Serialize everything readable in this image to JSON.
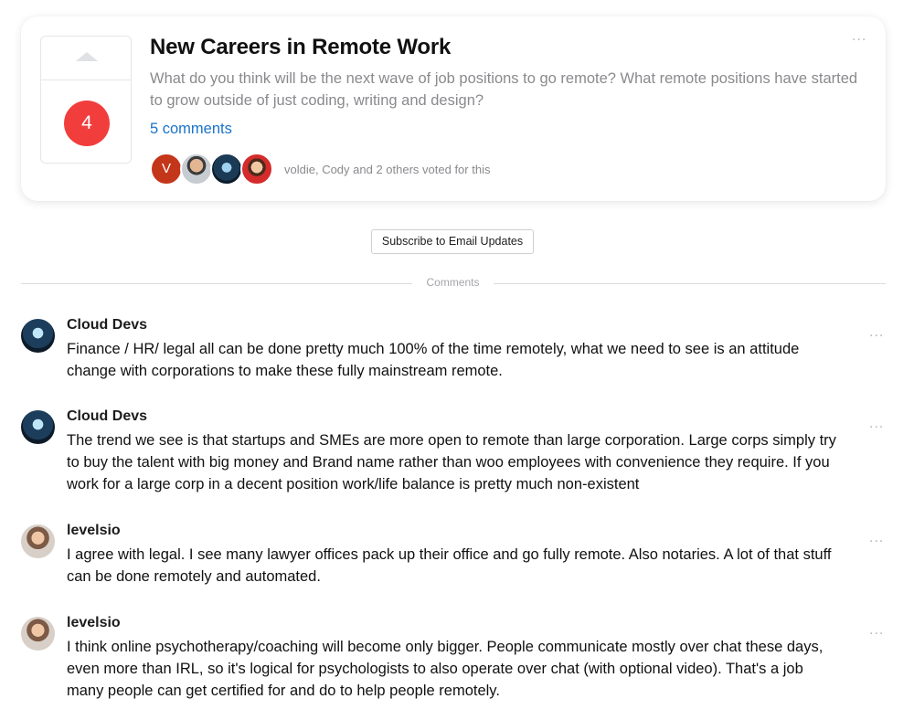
{
  "post": {
    "title": "New Careers in Remote Work",
    "description": "What do you think will be the next wave of job positions to go remote? What remote positions have started to grow outside of just coding, writing and design?",
    "comments_link": "5 comments",
    "vote_count": "4",
    "voters": [
      {
        "initial": "V",
        "color": "#c4361a"
      },
      {
        "initial": ""
      },
      {
        "initial": ""
      },
      {
        "initial": ""
      }
    ],
    "voters_text": "voldie, Cody and 2 others voted for this",
    "more_icon": "..."
  },
  "subscribe_label": "Subscribe to Email Updates",
  "comments_label": "Comments",
  "comments": [
    {
      "author": "Cloud Devs",
      "text": "Finance / HR/ legal all can be done pretty much 100% of the time remotely, what we need to see is an attitude change with corporations to make these fully mainstream remote.",
      "avatar": "cloud-devs-avatar"
    },
    {
      "author": "Cloud Devs",
      "text": "The trend we see is that startups and SMEs are more open to remote than large corporation. Large corps simply try to buy the talent with big money and Brand name rather than woo employees with convenience they require. If you work for a large corp in a decent position work/life balance is pretty much non-existent",
      "avatar": "cloud-devs-avatar"
    },
    {
      "author": "levelsio",
      "text": "I agree with legal. I see many lawyer offices pack up their office and go fully remote. Also notaries. A lot of that stuff can be done remotely and automated.",
      "avatar": "levelsio-avatar"
    },
    {
      "author": "levelsio",
      "text": "I think online psychotherapy/coaching will become only bigger. People communicate mostly over chat these days, even more than IRL, so it's logical for psychologists to also operate over chat (with optional video). That's a job many people can get certified for and do to help people remotely.",
      "avatar": "levelsio-avatar"
    }
  ],
  "colors": {
    "vote_badge": "#f23d3d",
    "link": "#1a73c9",
    "muted": "#8a8a8e"
  }
}
